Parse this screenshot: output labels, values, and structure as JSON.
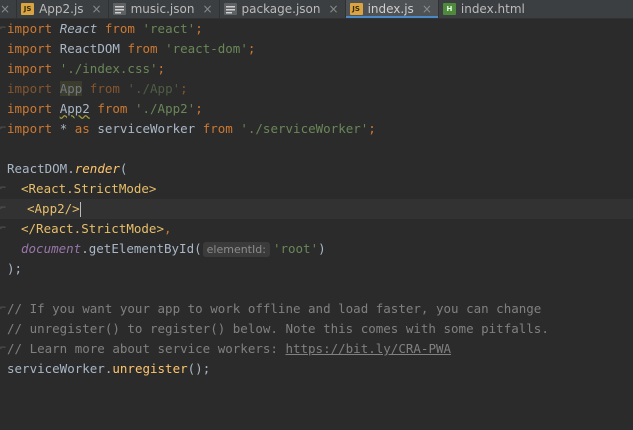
{
  "tabs": [
    {
      "label": "",
      "icon": "close-icon"
    },
    {
      "label": "App2.js",
      "icon": "js-file-icon",
      "badge": "JS"
    },
    {
      "label": "music.json",
      "icon": "json-file-icon",
      "badge": ""
    },
    {
      "label": "package.json",
      "icon": "json-file-icon",
      "badge": ""
    },
    {
      "label": "index.js",
      "icon": "js-file-icon",
      "badge": "JS",
      "active": true
    },
    {
      "label": "index.html",
      "icon": "html-file-icon",
      "badge": "H"
    }
  ],
  "close_glyph": "×",
  "code": {
    "l1": {
      "kw1": "import",
      "name": "React",
      "kw2": "from",
      "str": "'react'",
      "end": ";"
    },
    "l2": {
      "kw1": "import",
      "name": "ReactDOM",
      "kw2": "from",
      "str": "'react-dom'",
      "end": ";"
    },
    "l3": {
      "kw1": "import",
      "str": "'./index.css'",
      "end": ";"
    },
    "l4": {
      "kw1": "import",
      "name": "App",
      "kw2": "from",
      "str": "'./App'",
      "end": ";"
    },
    "l5": {
      "kw1": "import",
      "name": "App2",
      "kw2": "from",
      "str": "'./App2'",
      "end": ";"
    },
    "l6": {
      "kw1": "import",
      "star": "* ",
      "kw_as": "as",
      "name": "serviceWorker",
      "kw2": "from",
      "str": "'./serviceWorker'",
      "end": ";"
    },
    "l8": {
      "obj": "ReactDOM",
      "dot": ".",
      "fn": "render",
      "open": "("
    },
    "l9": {
      "tag": "<React.StrictMode>"
    },
    "l10": {
      "tag_open": "<App2",
      "tag_close": "/>"
    },
    "l11": {
      "tag": "</React.StrictMode>",
      "comma": ","
    },
    "l12": {
      "obj": "document",
      "dot": ".",
      "fn": "getElementById",
      "open": "(",
      "hint": "elementId:",
      "str": "'root'",
      "close": ")"
    },
    "l13": {
      "text": ");"
    },
    "l15": {
      "text": "// If you want your app to work offline and load faster, you can change"
    },
    "l16": {
      "text": "// unregister() to register() below. Note this comes with some pitfalls."
    },
    "l17": {
      "text": "// Learn more about service workers: ",
      "link": "https://bit.ly/CRA-PWA"
    },
    "l18": {
      "obj": "serviceWorker",
      "dot": ".",
      "fn": "unregister",
      "end": "();"
    }
  },
  "colors": {
    "background": "#2b2b2b",
    "keyword": "#cc7832",
    "string": "#6a8759",
    "function": "#ffc66d",
    "tag": "#e8bf6a",
    "comment": "#808080",
    "accent": "#4a88c7"
  }
}
